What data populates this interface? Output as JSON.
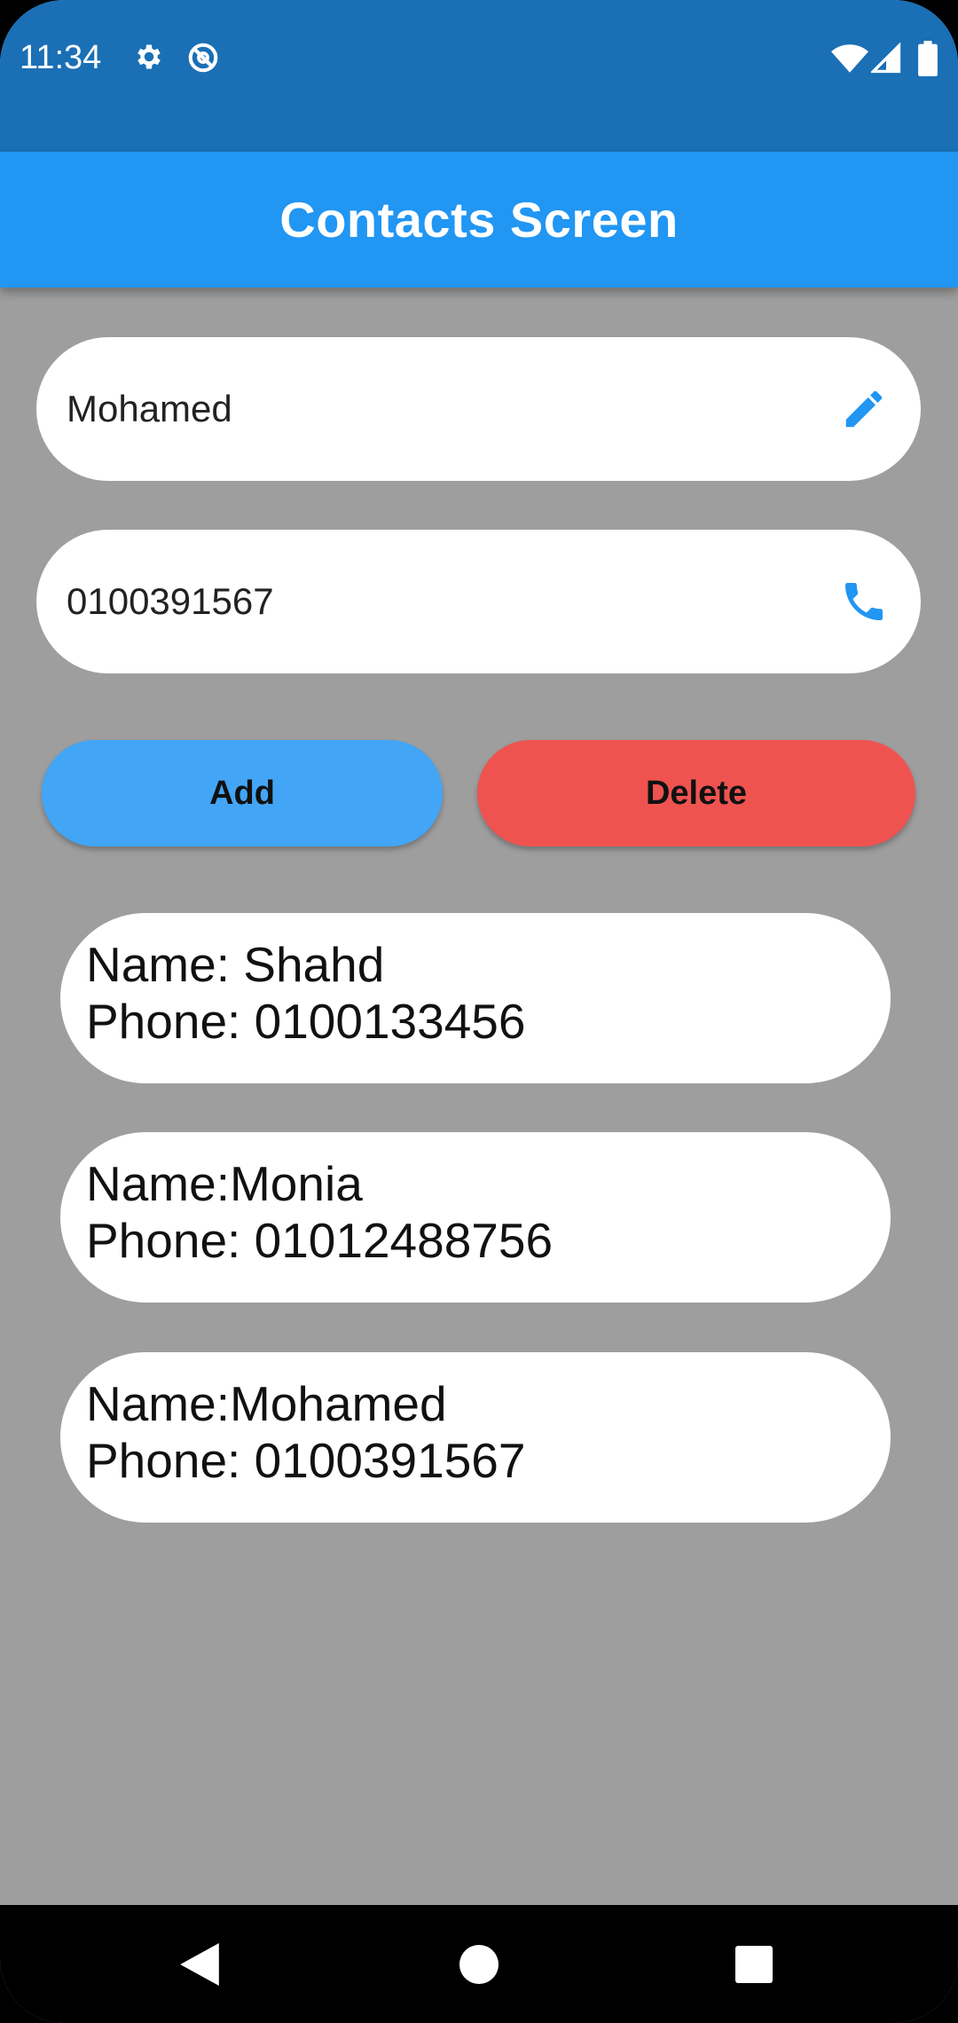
{
  "status_bar": {
    "time": "11:34",
    "left_icons": [
      "gear-icon",
      "do-not-disturb-icon"
    ],
    "right_icons": [
      "wifi-icon",
      "signal-icon",
      "battery-icon"
    ]
  },
  "app_bar": {
    "title": "Contacts Screen"
  },
  "form": {
    "name_field": {
      "value": "Mohamed",
      "icon": "edit-pencil-icon"
    },
    "phone_field": {
      "value": "0100391567",
      "icon": "phone-icon"
    },
    "add_label": "Add",
    "delete_label": "Delete"
  },
  "contacts": [
    {
      "name_line": "Name: Shahd",
      "phone_line": "Phone: 0100133456"
    },
    {
      "name_line": "Name:Monia",
      "phone_line": "Phone: 01012488756"
    },
    {
      "name_line": "Name:Mohamed",
      "phone_line": "Phone: 0100391567"
    }
  ],
  "nav_bar": {
    "buttons": [
      "back-icon",
      "home-icon",
      "recents-icon"
    ]
  },
  "colors": {
    "status_bar": "#1a6fb5",
    "app_bar": "#2196f3",
    "background": "#9e9e9e",
    "add_button": "#42a5f5",
    "delete_button": "#ef5350",
    "icon_blue": "#2196f3"
  }
}
